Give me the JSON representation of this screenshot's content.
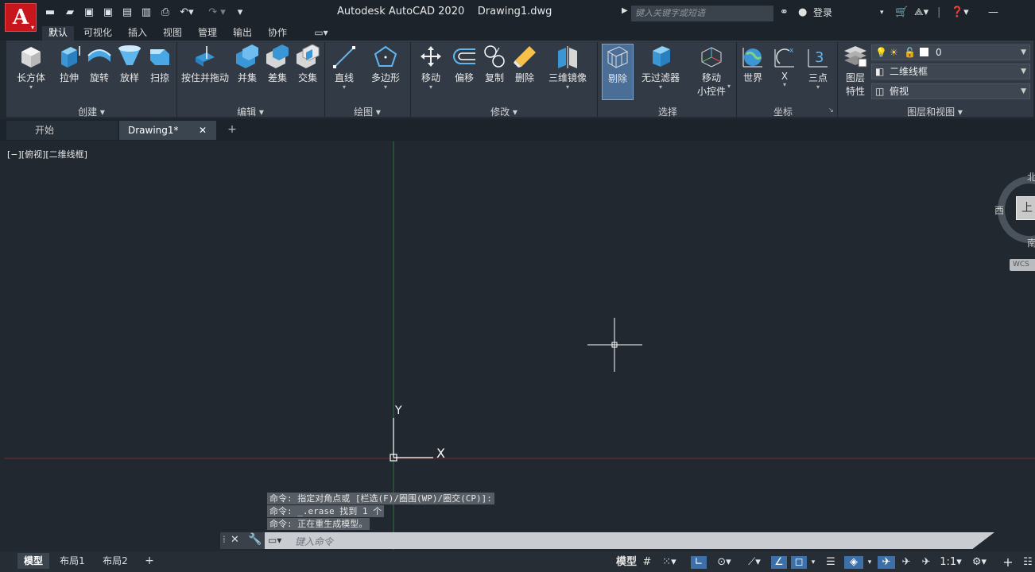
{
  "app": {
    "logo": "A",
    "title": "Autodesk AutoCAD 2020    Drawing1.dwg"
  },
  "search": {
    "placeholder": "键入关键字或短语"
  },
  "user": {
    "login": "登录"
  },
  "menu_tabs": [
    "默认",
    "可视化",
    "插入",
    "视图",
    "管理",
    "输出",
    "协作"
  ],
  "ribbon": {
    "create": {
      "title": "创建",
      "tools": [
        "长方体",
        "拉伸",
        "旋转",
        "放样",
        "扫掠"
      ]
    },
    "edit": {
      "title": "编辑",
      "tools": [
        "按住并拖动",
        "并集",
        "差集",
        "交集"
      ]
    },
    "draw": {
      "title": "绘图",
      "tools": [
        "直线",
        "多边形"
      ]
    },
    "modify": {
      "title": "修改",
      "tools": [
        "移动",
        "偏移",
        "复制",
        "删除",
        "三维镜像"
      ]
    },
    "select": {
      "title": "选择",
      "tools": [
        "剔除",
        "无过滤器",
        "移动",
        "小控件"
      ]
    },
    "coords": {
      "title": "坐标",
      "tools": [
        "世界",
        "X",
        "三点"
      ]
    },
    "layers": {
      "title": "图层和视图",
      "layer_props_1": "图层",
      "layer_props_2": "特性",
      "layer_name": "0",
      "visual_style": "二维线框",
      "view": "俯视"
    }
  },
  "doc_tabs": {
    "start": "开始",
    "drawing": "Drawing1*"
  },
  "viewport": {
    "label": "[−][俯视][二维线框]"
  },
  "ucs": {
    "x": "X",
    "y": "Y"
  },
  "viewcube": {
    "north": "北",
    "west": "西",
    "south": "南",
    "top": "上",
    "wcs": "WCS"
  },
  "command": {
    "history": [
      "命令: 指定对角点或 [栏选(F)/圈围(WP)/圈交(CP)]:",
      "命令: _.erase 找到 1 个",
      "命令: 正在重生成模型。"
    ],
    "placeholder": "键入命令"
  },
  "layout_tabs": [
    "模型",
    "布局1",
    "布局2"
  ],
  "status": {
    "model": "模型",
    "scale": "1:1"
  },
  "colors": {
    "accent": "#3d6fa8",
    "background": "#212830",
    "ribbon": "#313a45"
  }
}
